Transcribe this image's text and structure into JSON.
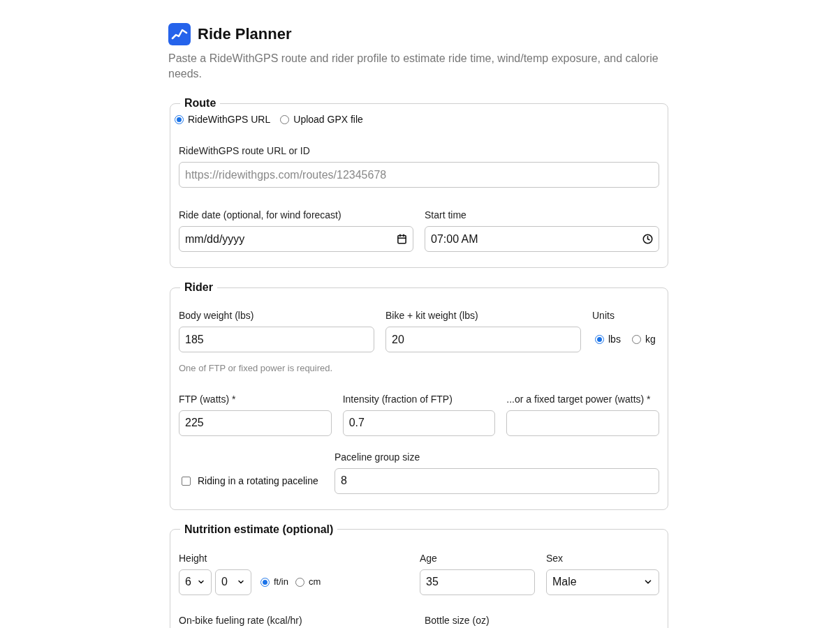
{
  "header": {
    "title": "Ride Planner",
    "subtitle": "Paste a RideWithGPS route and rider profile to estimate ride time, wind/temp exposure, and calorie needs."
  },
  "route": {
    "legend": "Route",
    "source_options": [
      {
        "label": "RideWithGPS URL",
        "selected": true
      },
      {
        "label": "Upload GPX file",
        "selected": false
      }
    ],
    "url_field": {
      "label": "RideWithGPS route URL or ID",
      "placeholder": "https://ridewithgps.com/routes/12345678"
    },
    "date_field": {
      "label": "Ride date (optional, for wind forecast)",
      "value": "mm/dd/yyyy"
    },
    "time_field": {
      "label": "Start time",
      "value": "07:00 AM"
    }
  },
  "rider": {
    "legend": "Rider",
    "body_weight": {
      "label": "Body weight (lbs)",
      "value": "185"
    },
    "bike_weight": {
      "label": "Bike + kit weight (lbs)",
      "value": "20"
    },
    "units": {
      "label": "Units",
      "options": [
        {
          "label": "lbs",
          "selected": true
        },
        {
          "label": "kg",
          "selected": false
        }
      ]
    },
    "note": "One of FTP or fixed power is required.",
    "ftp": {
      "label": "FTP (watts) *",
      "value": "225"
    },
    "intensity": {
      "label": "Intensity (fraction of FTP)",
      "value": "0.7"
    },
    "target_power": {
      "label": "...or a fixed target power (watts) *"
    },
    "paceline": {
      "label": "Riding in a rotating paceline",
      "checked": false
    },
    "group_size": {
      "label": "Paceline group size",
      "value": "8"
    }
  },
  "nutrition": {
    "legend": "Nutrition estimate (optional)",
    "height": {
      "label": "Height",
      "feet": "6",
      "inches": "0",
      "options": [
        {
          "label": "ft/in",
          "selected": true
        },
        {
          "label": "cm",
          "selected": false
        }
      ]
    },
    "age": {
      "label": "Age",
      "value": "35"
    },
    "sex": {
      "label": "Sex",
      "value": "Male"
    },
    "fueling_rate": {
      "label": "On-bike fueling rate (kcal/hr)"
    },
    "bottle_size": {
      "label": "Bottle size (oz)"
    }
  }
}
